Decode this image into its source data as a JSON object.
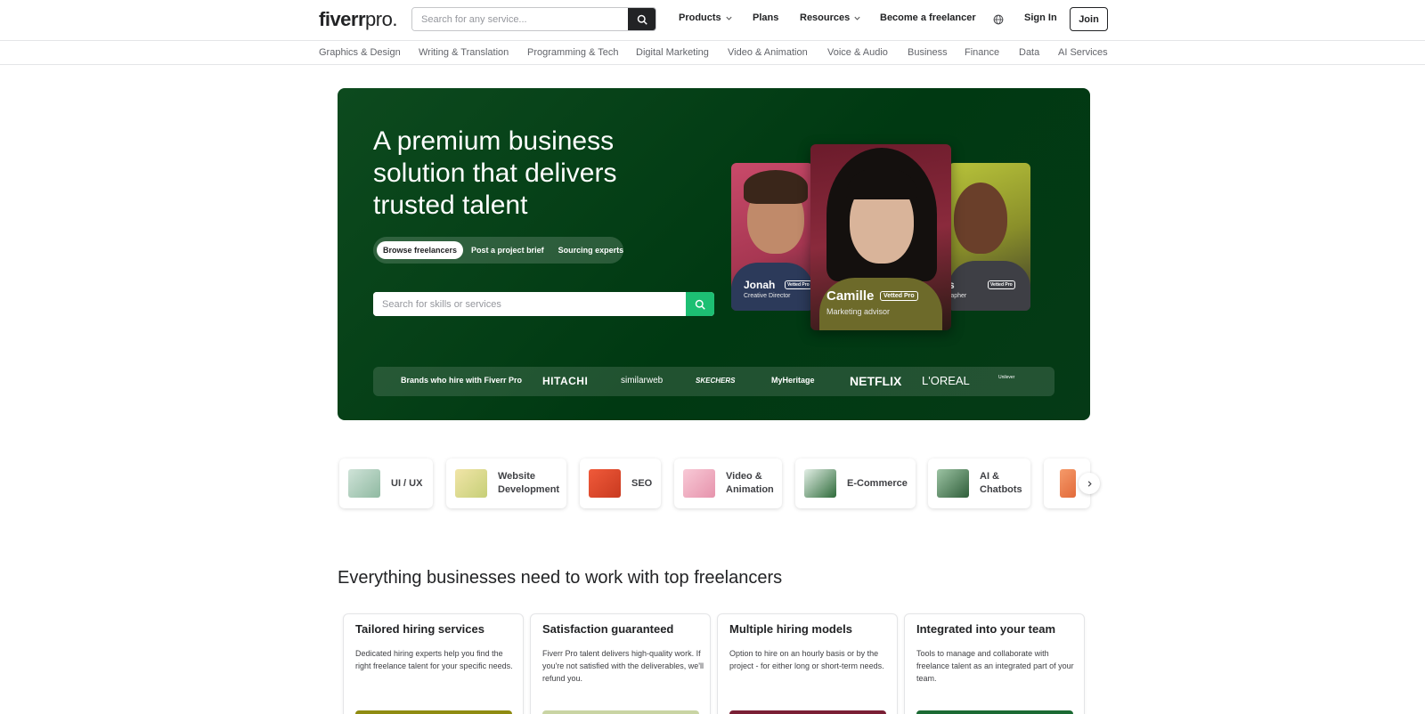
{
  "header": {
    "logo_main": "fiverr",
    "logo_sub": "pro.",
    "search_placeholder": "Search for any service...",
    "nav": {
      "products": "Products",
      "plans": "Plans",
      "resources": "Resources",
      "become_freelancer": "Become a freelancer",
      "sign_in": "Sign In",
      "join": "Join"
    }
  },
  "categories": [
    "Graphics & Design",
    "Writing & Translation",
    "Programming & Tech",
    "Digital Marketing",
    "Video & Animation",
    "Voice & Audio",
    "Business",
    "Finance",
    "Data",
    "AI Services"
  ],
  "hero": {
    "title": "A premium business solution that delivers trusted talent",
    "tabs": [
      "Browse freelancers",
      "Post a project brief",
      "Sourcing experts"
    ],
    "search_placeholder": "Search for skills or services",
    "cards": {
      "left": {
        "name": "Jonah",
        "role": "Creative Director",
        "badge": "Vetted Pro"
      },
      "mid": {
        "name": "Camille",
        "role": "Marketing advisor",
        "badge": "Vetted Pro"
      },
      "right": {
        "name": "s",
        "role": "rapher",
        "badge": "Vetted Pro"
      }
    },
    "brands_label": "Brands who hire with Fiverr Pro",
    "brands": [
      "HITACHI",
      "similarweb",
      "SKECHERS",
      "MyHeritage",
      "NETFLIX",
      "L'OREAL",
      "Unilever"
    ]
  },
  "services": [
    {
      "label": "UI / UX"
    },
    {
      "label": "Website Development"
    },
    {
      "label": "SEO"
    },
    {
      "label": "Video & Animation"
    },
    {
      "label": "E-Commerce"
    },
    {
      "label": "AI & Chatbots"
    }
  ],
  "features": {
    "section_title": "Everything businesses need to work with top freelancers",
    "items": [
      {
        "title": "Tailored hiring services",
        "desc": "Dedicated hiring experts help you find the right freelance talent for your specific needs.",
        "color": "#8f8b11"
      },
      {
        "title": "Satisfaction guaranteed",
        "desc": "Fiverr Pro talent delivers high-quality work. If you're not satisfied with the deliverables, we'll refund you.",
        "color": "#c9d4a3"
      },
      {
        "title": "Multiple hiring models",
        "desc": "Option to hire on an hourly basis or by the project - for either long or short-term needs.",
        "color": "#7a1f35"
      },
      {
        "title": "Integrated into your team",
        "desc": "Tools to manage and collaborate with freelance talent as an integrated part of your team.",
        "color": "#1b6a33"
      }
    ]
  },
  "colors": {
    "hero_green": "#003912",
    "accent_green": "#1dbf73",
    "dark": "#222325"
  },
  "icons": [
    "search-icon",
    "globe-icon",
    "chevron-down-icon",
    "chevron-right-icon"
  ]
}
